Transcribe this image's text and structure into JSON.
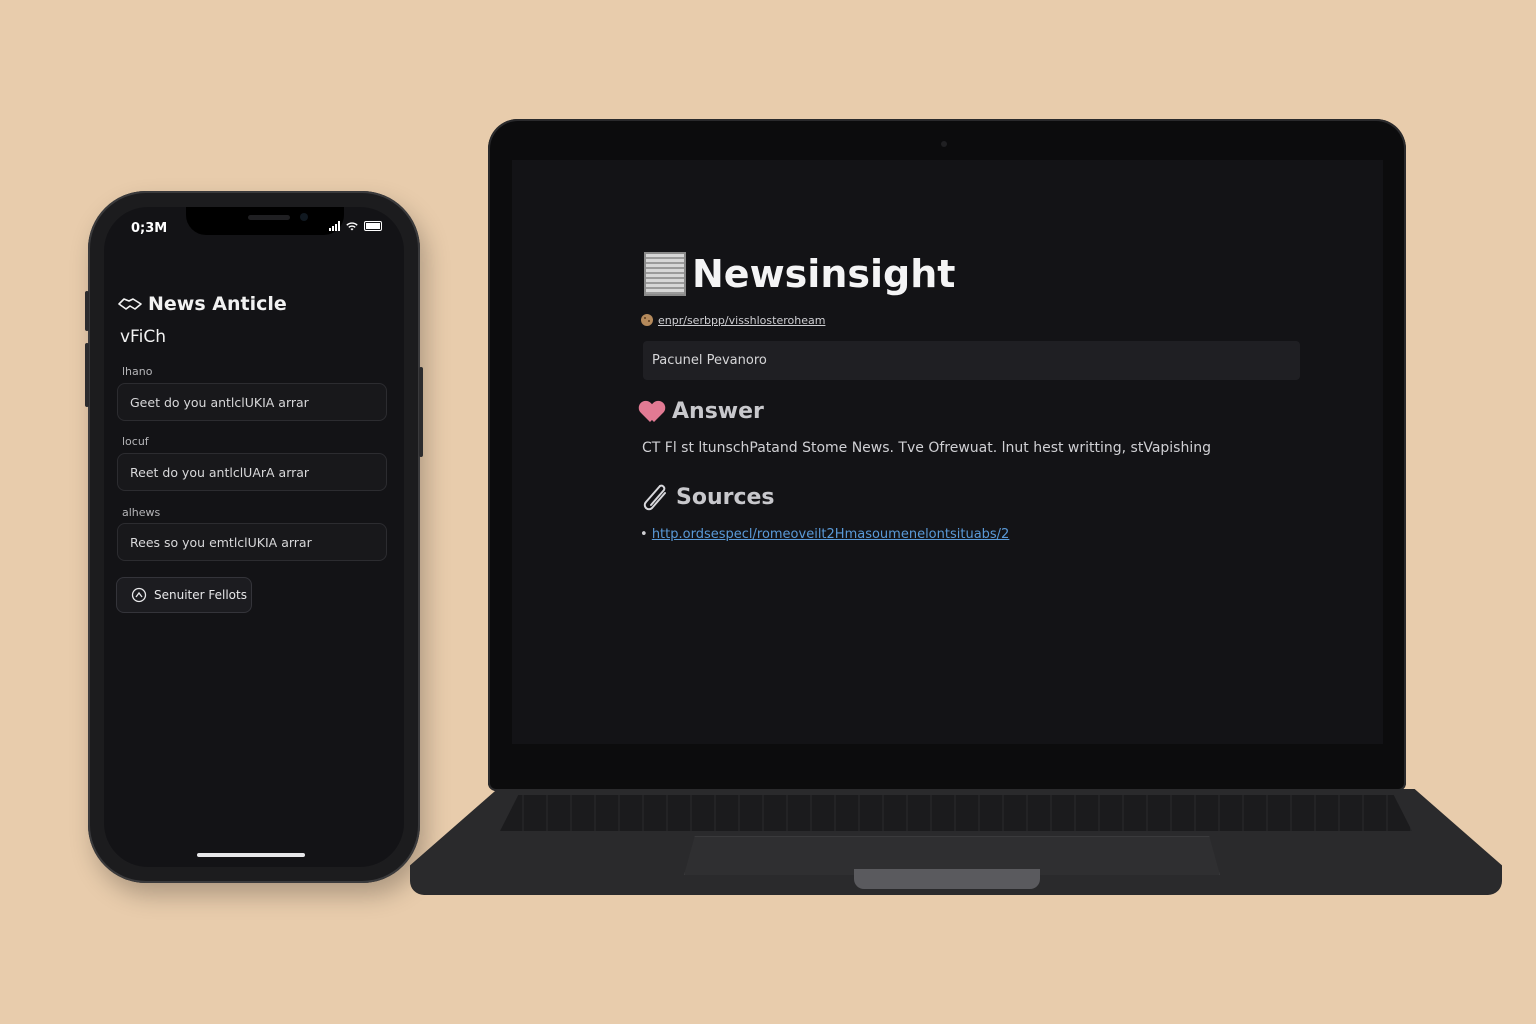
{
  "phone": {
    "status_time": "0;3M",
    "title": "News Anticle",
    "title_icon": "handshake-icon",
    "subtitle": "vFiCh",
    "fields": [
      {
        "label": "lhano",
        "value": "Geet do you antlclUKIA arrar"
      },
      {
        "label": "locuf",
        "value": "Reet do you antlclUArA arrar"
      },
      {
        "label": "alhews",
        "value": "Rees so you emtlclUKIA arrar"
      }
    ],
    "button_label": "Senuiter Fellots",
    "button_icon": "filter-icon"
  },
  "laptop": {
    "app_title": "Newsinsight",
    "title_icon": "newspaper-icon",
    "app_url": "enpr/serbpp/visshlosteroheam",
    "url_icon": "cookie-icon",
    "search_value": "Pacunel Pevanoro",
    "answer_heading": "Answer",
    "answer_icon": "heart-icon",
    "answer_text": "CT Fl st ltunschPatand Stome News. Tve Ofrewuat. lnut hest writting, stVapishing",
    "sources_heading": "Sources",
    "sources_icon": "paperclip-icon",
    "source_bullet": "•",
    "source_link": "http.ordsespecl/romeoveilt2Hmasoumenelontsituabs/2"
  },
  "colors": {
    "background": "#e8ccac",
    "screen": "#131316",
    "link": "#5a9ad8",
    "heart": "#e27a93"
  }
}
